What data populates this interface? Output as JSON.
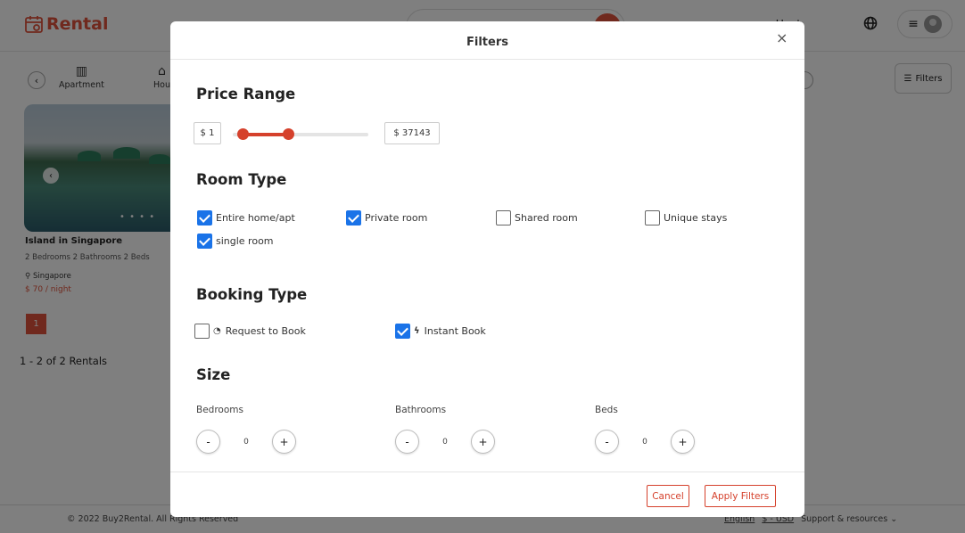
{
  "header": {
    "logo_text": "Rental",
    "host_text": "a Host",
    "menu_glyph": "≡"
  },
  "categories": [
    {
      "label": "Apartment",
      "icon": "building-icon"
    },
    {
      "label": "Hou",
      "icon": "house-icon"
    }
  ],
  "filters_button": "Filters",
  "listing": {
    "title": "Island in Singapore",
    "specs": "2 Bedrooms  2 Bathrooms  2 Beds",
    "location": "Singapore",
    "price": "$ 70 / night",
    "image_dots": "• • • •"
  },
  "pagination": {
    "current": "1"
  },
  "results_count": "1 - 2 of 2 Rentals",
  "footer": {
    "copyright": "© 2022 Buy2Rental. All Rights Reserved",
    "language": "English",
    "currency": "$ - USD",
    "support": "Support & resources"
  },
  "modal": {
    "title": "Filters",
    "close": "×",
    "price_range": {
      "heading": "Price Range",
      "min_label": "$ 1",
      "max_label": "$ 37143",
      "slider_low": 0.07,
      "slider_high": 0.41
    },
    "room_type": {
      "heading": "Room Type",
      "options": [
        {
          "label": "Entire home/apt",
          "checked": true
        },
        {
          "label": "Private room",
          "checked": true
        },
        {
          "label": "Shared room",
          "checked": false
        },
        {
          "label": "Unique stays",
          "checked": false
        },
        {
          "label": "single room",
          "checked": true
        }
      ]
    },
    "booking_type": {
      "heading": "Booking Type",
      "options": [
        {
          "label": "Request to Book",
          "checked": false,
          "icon": "clock-icon"
        },
        {
          "label": "Instant Book",
          "checked": true,
          "icon": "lightning-icon"
        }
      ]
    },
    "size": {
      "heading": "Size",
      "fields": [
        {
          "label": "Bedrooms",
          "value": "0"
        },
        {
          "label": "Bathrooms",
          "value": "0"
        },
        {
          "label": "Beds",
          "value": "0"
        }
      ],
      "minus": "-",
      "plus": "+"
    },
    "cancel_label": "Cancel",
    "apply_label": "Apply Filters"
  },
  "colors": {
    "brand": "#e0533c",
    "check": "#1a73e8",
    "slider": "#d5412c"
  }
}
